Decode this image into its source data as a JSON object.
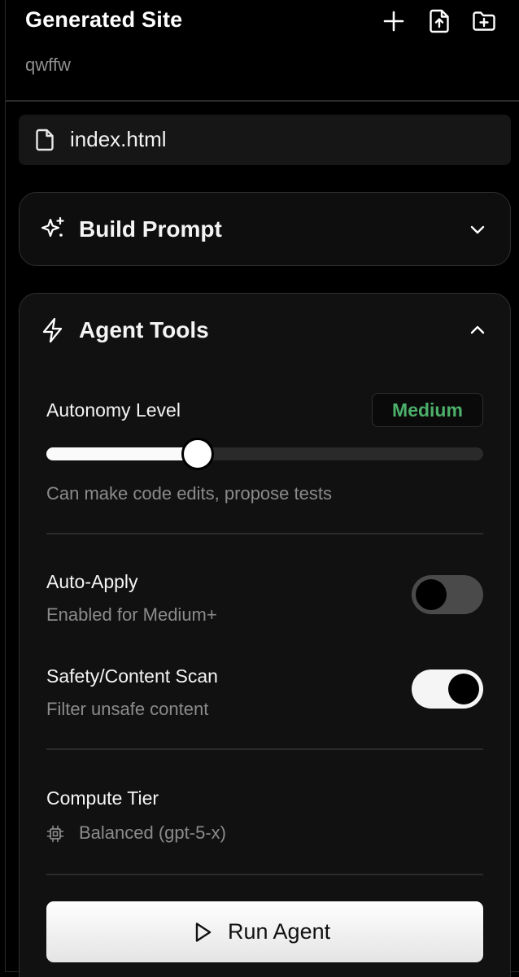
{
  "sidebar": {
    "title": "Generated Site",
    "subtitle": "qwffw",
    "icons": {
      "new": "plus-icon",
      "upload": "file-upload-icon",
      "new_folder": "folder-plus-icon"
    }
  },
  "files": [
    {
      "name": "index.html",
      "icon": "file-icon"
    }
  ],
  "build_prompt": {
    "title": "Build Prompt",
    "icon": "sparkles-icon",
    "expanded": false
  },
  "agent_tools": {
    "title": "Agent Tools",
    "icon": "lightning-icon",
    "expanded": true,
    "autonomy": {
      "label": "Autonomy Level",
      "value": "Medium",
      "level_fraction": 0.345,
      "description": "Can make code edits, propose tests",
      "badge_color": "#4caf6a"
    },
    "auto_apply": {
      "label": "Auto-Apply",
      "description": "Enabled for Medium+",
      "enabled": false
    },
    "safety_scan": {
      "label": "Safety/Content Scan",
      "description": "Filter unsafe content",
      "enabled": true
    },
    "compute_tier": {
      "label": "Compute Tier",
      "value": "Balanced (gpt-5-x)",
      "icon": "cpu-chip-icon"
    },
    "run_button": {
      "label": "Run Agent",
      "icon": "play-icon"
    }
  }
}
